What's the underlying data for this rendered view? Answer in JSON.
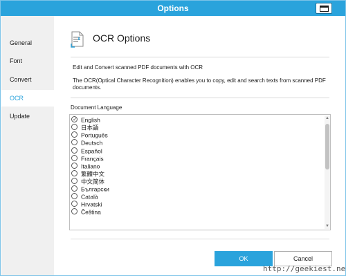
{
  "window": {
    "title": "Options"
  },
  "sidebar": {
    "items": [
      {
        "label": "General",
        "active": false
      },
      {
        "label": "Font",
        "active": false
      },
      {
        "label": "Convert",
        "active": false
      },
      {
        "label": "OCR",
        "active": true
      },
      {
        "label": "Update",
        "active": false
      }
    ]
  },
  "main": {
    "heading": "OCR Options",
    "description_line1": "Edit and Convert scanned PDF documents with OCR",
    "description_line2": "The OCR(Optical Character Recognition) enables you to copy, edit and search texts from scanned PDF documents.",
    "language_label": "Document Language",
    "languages": [
      {
        "name": "English",
        "checked": true
      },
      {
        "name": "日本語",
        "checked": false
      },
      {
        "name": "Português",
        "checked": false
      },
      {
        "name": "Deutsch",
        "checked": false
      },
      {
        "name": "Español",
        "checked": false
      },
      {
        "name": "Français",
        "checked": false
      },
      {
        "name": "Italiano",
        "checked": false
      },
      {
        "name": "繁體中文",
        "checked": false
      },
      {
        "name": "中文简体",
        "checked": false
      },
      {
        "name": "Български",
        "checked": false
      },
      {
        "name": "Català",
        "checked": false
      },
      {
        "name": "Hrvatski",
        "checked": false
      },
      {
        "name": "Čeština",
        "checked": false
      }
    ]
  },
  "footer": {
    "ok_label": "OK",
    "cancel_label": "Cancel"
  },
  "watermark": "http://geekiest.net",
  "colors": {
    "accent": "#2aa3dc",
    "sidebar_bg": "#f0f0f0"
  }
}
